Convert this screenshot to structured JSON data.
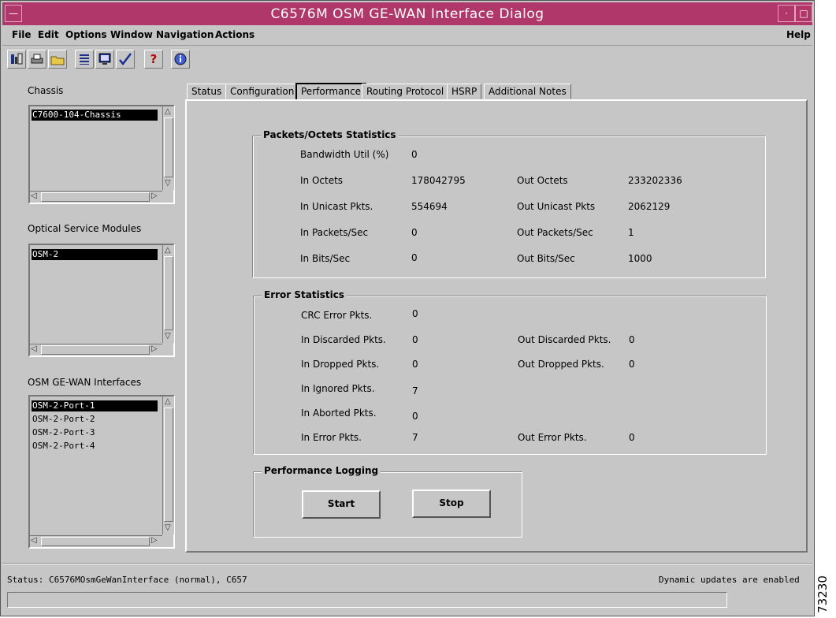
{
  "window": {
    "title": "C6576M OSM GE-WAN Interface Dialog"
  },
  "menu": {
    "file": "File",
    "edit": "Edit",
    "options": "Options",
    "window": "Window",
    "navigation": "Navigation",
    "actions": "Actions",
    "help": "Help"
  },
  "toolbar": {
    "icons": [
      "print-preview-icon",
      "print-icon",
      "open-folder-icon",
      "list-icon",
      "monitor-icon",
      "checkmark-icon",
      "help-icon",
      "info-icon"
    ]
  },
  "sidebar": {
    "chassis_label": "Chassis",
    "chassis_items": [
      "C7600-104-Chassis"
    ],
    "osm_label": "Optical Service Modules",
    "osm_items": [
      "OSM-2"
    ],
    "iface_label": "OSM GE-WAN Interfaces",
    "iface_items": [
      "OSM-2-Port-1",
      "OSM-2-Port-2",
      "OSM-2-Port-3",
      "OSM-2-Port-4"
    ]
  },
  "tabs": [
    "Status",
    "Configuration",
    "Performance",
    "Routing Protocol",
    "HSRP",
    "Additional Notes"
  ],
  "active_tab": "Performance",
  "packets": {
    "title": "Packets/Octets Statistics",
    "bandwidth_label": "Bandwidth Util (%)",
    "bandwidth_value": "0",
    "in_octets_label": "In Octets",
    "in_octets_value": "178042795",
    "out_octets_label": "Out Octets",
    "out_octets_value": "233202336",
    "in_unicast_label": "In Unicast Pkts.",
    "in_unicast_value": "554694",
    "out_unicast_label": "Out Unicast Pkts",
    "out_unicast_value": "2062129",
    "in_pps_label": "In Packets/Sec",
    "in_pps_value": "0",
    "out_pps_label": "Out Packets/Sec",
    "out_pps_value": "1",
    "in_bps_label": "In Bits/Sec",
    "in_bps_value": "0",
    "out_bps_label": "Out Bits/Sec",
    "out_bps_value": "1000"
  },
  "errors": {
    "title": "Error Statistics",
    "crc_label": "CRC Error Pkts.",
    "crc_value": "0",
    "in_discarded_label": "In Discarded Pkts.",
    "in_discarded_value": "0",
    "out_discarded_label": "Out Discarded Pkts.",
    "out_discarded_value": "0",
    "in_dropped_label": "In Dropped Pkts.",
    "in_dropped_value": "0",
    "out_dropped_label": "Out Dropped Pkts.",
    "out_dropped_value": "0",
    "in_ignored_label": "In Ignored Pkts.",
    "in_ignored_value": "7",
    "in_aborted_label": "In Aborted Pkts.",
    "in_aborted_value": "0",
    "in_error_label": "In Error Pkts.",
    "in_error_value": "7",
    "out_error_label": "Out Error Pkts.",
    "out_error_value": "0"
  },
  "logging": {
    "title": "Performance Logging",
    "start": "Start",
    "stop": "Stop"
  },
  "status": {
    "left": "Status: C6576MOsmGeWanInterface (normal), C657",
    "right": "Dynamic updates are enabled"
  },
  "figure_number": "73230"
}
